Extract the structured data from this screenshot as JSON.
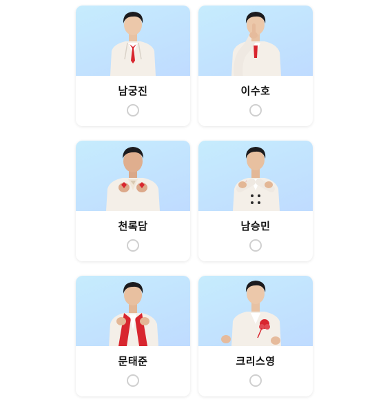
{
  "candidates": [
    {
      "name": "남궁진",
      "accent": "#d8262f",
      "pose": "arms-down",
      "selected": false
    },
    {
      "name": "이수호",
      "accent": "#d8262f",
      "pose": "finger-on-lips",
      "selected": false
    },
    {
      "name": "천록담",
      "accent": "#d8262f",
      "pose": "finger-hearts",
      "selected": false
    },
    {
      "name": "남승민",
      "accent": "#d8262f",
      "pose": "pointing",
      "selected": false
    },
    {
      "name": "문태준",
      "accent": "#d8262f",
      "pose": "finger-hearts-red-lapels",
      "selected": false
    },
    {
      "name": "크리스영",
      "accent": "#d8262f",
      "pose": "flower-corsage",
      "selected": false
    }
  ],
  "colors": {
    "photo_background_top": "#c6ecfd",
    "photo_background_bottom": "#bfdbff",
    "suit": "#f4efe8",
    "radio_border": "#cfcfcf"
  }
}
